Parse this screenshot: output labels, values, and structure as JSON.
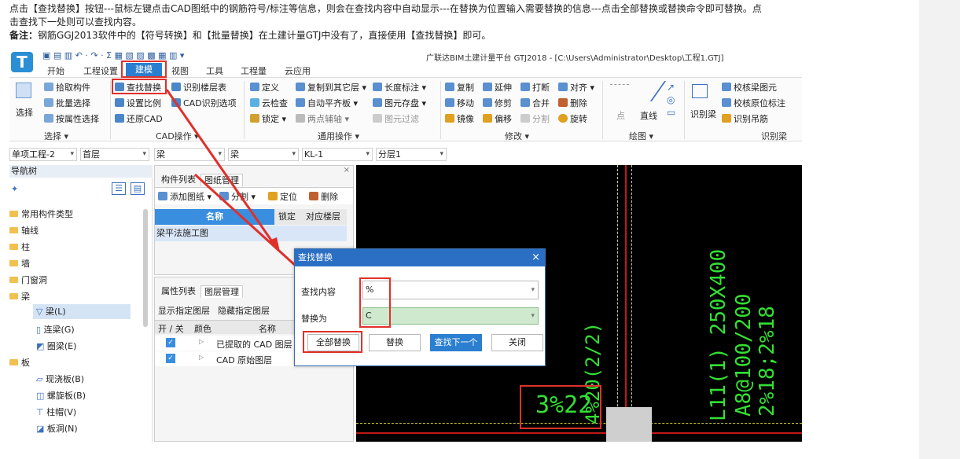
{
  "doc": {
    "line1": "点击【查找替换】按钮---鼠标左键点击CAD图纸中的钢筋符号/标注等信息，则会在查找内容中自动显示---在替换为位置输入需要替换的信息---点击全部替换或替换命令即可替换。点",
    "line2": "击查找下一处则可以查找内容。",
    "note_label": "备注：",
    "note_text": "钢筋GGJ2013软件中的【符号转换】和【批量替换】在土建计量GTJ中没有了，直接使用【查找替换】即可。"
  },
  "window": {
    "title": "广联达BIM土建计量平台 GTJ2018 - [C:\\Users\\Administrator\\Desktop\\工程1.GTJ]",
    "logo": "T"
  },
  "menu": {
    "tabs": [
      "开始",
      "工程设置",
      "建模",
      "视图",
      "工具",
      "工程量",
      "云应用"
    ]
  },
  "ribbon": {
    "select": {
      "big": "选择",
      "pick": "拾取构件",
      "batch": "批量选择",
      "byattr": "按属性选择",
      "group": "选择 ▾"
    },
    "cad": {
      "find": "查找替换",
      "scale": "设置比例",
      "restore": "还原CAD",
      "layer": "识别楼层表",
      "cadopt": "CAD识别选项",
      "group": "CAD操作 ▾"
    },
    "common": {
      "define": "定义",
      "cloud": "云检查",
      "lock": "锁定 ▾",
      "copyto": "复制到其它层 ▾",
      "autoflat": "自动平齐板 ▾",
      "twopoint": "两点辅轴 ▾",
      "length": "长度标注 ▾",
      "store": "图元存盘 ▾",
      "filter": "图元过滤",
      "group": "通用操作 ▾"
    },
    "modify": {
      "copy": "复制",
      "move": "移动",
      "mirror": "镜像",
      "extend": "延伸",
      "trim": "修剪",
      "offset": "偏移",
      "break": "打断",
      "merge": "合并",
      "split": "分割",
      "align": "对齐 ▾",
      "delete": "删除",
      "rotate": "旋转",
      "group": "修改 ▾"
    },
    "draw": {
      "point": "点",
      "line": "直线",
      "group": "绘图 ▾"
    },
    "recog": {
      "beam": "识别梁",
      "check": "校核梁图元",
      "checkorig": "校核原位标注",
      "hanger": "识别吊筋",
      "group": "识别梁"
    }
  },
  "selectors": {
    "project": "单项工程-2",
    "floor": "首层",
    "type": "梁",
    "sub": "梁",
    "comp": "KL-1",
    "layer": "分层1"
  },
  "nav": {
    "title": "导航树",
    "items": [
      "常用构件类型",
      "轴线",
      "柱",
      "墙",
      "门窗洞",
      "梁",
      "梁(L)",
      "连梁(G)",
      "圈梁(E)",
      "板",
      "现浇板(B)",
      "螺旋板(B)",
      "柱帽(V)",
      "板洞(N)"
    ]
  },
  "panel1": {
    "tab1": "构件列表",
    "tab2": "图纸管理",
    "add": "添加图纸 ▾",
    "split": "分割 ▾",
    "locate": "定位",
    "delete": "删除",
    "col_name": "名称",
    "col_lock": "锁定",
    "col_floor": "对应楼层",
    "row": "梁平法施工图"
  },
  "panel2": {
    "tab1": "属性列表",
    "tab2": "图层管理",
    "show": "显示指定图层",
    "hide": "隐藏指定图层",
    "col_onoff": "开 / 关",
    "col_color": "颜色",
    "col_name": "名称",
    "rows": [
      "已提取的 CAD 图层",
      "CAD 原始图层"
    ]
  },
  "dialog": {
    "title": "查找替换",
    "find_label": "查找内容",
    "find_value": "%",
    "replace_label": "替换为",
    "replace_value": "C",
    "btn_all": "全部替换",
    "btn_replace": "替换",
    "btn_next": "查找下一个",
    "btn_close": "关闭",
    "close_x": "×"
  },
  "cad_text": {
    "v1": "4%20(2/2)",
    "v2": "L11(1) 250X400",
    "v3": "A8@100/200",
    "v4": "2%18;2%18",
    "bottom": "3%22"
  },
  "colors": {
    "accent": "#2b7fd0",
    "highlight": "#e0302a",
    "cad_text": "#33e033"
  }
}
